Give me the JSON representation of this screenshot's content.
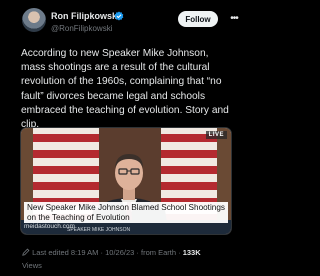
{
  "author": {
    "display_name": "Ron Filipkowski",
    "handle": "@RonFilipkowski",
    "verified_color": "#1d9bf0"
  },
  "follow_label": "Follow",
  "more_icon": "more-dots-icon",
  "tweet_text": "According to new Speaker Mike Johnson, mass shootings are a result of the cultural revolution of the 1960s, complaining that “no fault” divorces became legal and schools embraced the teaching of evolution. Story and clip.",
  "link_card": {
    "live_badge": "LIVE",
    "headline": "New Speaker Mike Johnson Blamed School Shootings on the Teaching of Evolution",
    "domain": "meidastouch.com",
    "chyron": "SPEAKER MIKE JOHNSON"
  },
  "meta": {
    "edited_label": "Last edited",
    "time": "8:19 AM",
    "date": "10/26/23",
    "source": "from Earth",
    "views_count": "133K",
    "views_label": "Views",
    "separator": "·"
  }
}
